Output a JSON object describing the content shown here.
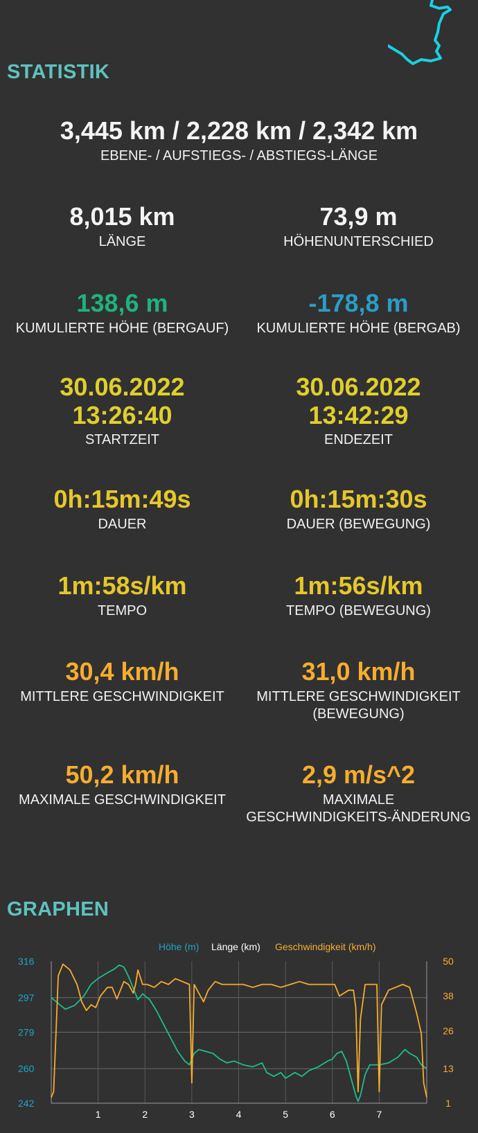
{
  "colors": {
    "background": "#313131",
    "section_title": "#5fc2bd",
    "elevation": "#1ea6c9",
    "distance": "#ffffff",
    "speed": "#f6ad2e",
    "elevation_line": "#1dbd8e"
  },
  "stats_title": "STATISTIK",
  "graphs_title": "GRAPHEN",
  "stats": {
    "segment_lengths": {
      "value": "3,445 km / 2,228 km / 2,342 km",
      "label": "EBENE- / AUFSTIEGS- / ABSTIEGS-LÄNGE"
    },
    "length": {
      "value": "8,015 km",
      "label": "LÄNGE"
    },
    "height_diff": {
      "value": "73,9 m",
      "label": "HÖHENUNTERSCHIED"
    },
    "ascent": {
      "value": "138,6 m",
      "label": "KUMULIERTE HÖHE (BERGAUF)"
    },
    "descent": {
      "value": "-178,8 m",
      "label": "KUMULIERTE HÖHE (BERGAB)"
    },
    "start": {
      "date": "30.06.2022",
      "time": "13:26:40",
      "label": "STARTZEIT"
    },
    "end": {
      "date": "30.06.2022",
      "time": "13:42:29",
      "label": "ENDEZEIT"
    },
    "duration": {
      "value": "0h:15m:49s",
      "label": "DAUER"
    },
    "duration_moving": {
      "value": "0h:15m:30s",
      "label": "DAUER (BEWEGUNG)"
    },
    "pace": {
      "value": "1m:58s/km",
      "label": "TEMPO"
    },
    "pace_moving": {
      "value": "1m:56s/km",
      "label": "TEMPO (BEWEGUNG)"
    },
    "avg_speed": {
      "value": "30,4 km/h",
      "label": "MITTLERE GESCHWINDIGKEIT"
    },
    "avg_speed_moving": {
      "value": "31,0 km/h",
      "label_line1": "MITTLERE GESCHWINDIGKEIT",
      "label_line2": "(BEWEGUNG)"
    },
    "max_speed": {
      "value": "50,2 km/h",
      "label": "MAXIMALE GESCHWINDIGKEIT"
    },
    "max_accel": {
      "value": "2,9 m/s^2",
      "label_line1": "MAXIMALE",
      "label_line2": "GESCHWINDIGKEITS-ÄNDERUNG"
    }
  },
  "chart_data": {
    "type": "line",
    "legend": [
      "Höhe (m)",
      "Länge (km)",
      "Geschwindigkeit (km/h)"
    ],
    "x_ticks": [
      1,
      2,
      3,
      4,
      5,
      6,
      7
    ],
    "xlim": [
      0,
      8.015
    ],
    "y_left_ticks": [
      242,
      260,
      279,
      297,
      316
    ],
    "y_right_ticks": [
      1,
      13,
      26,
      38,
      50
    ],
    "ylim_left": [
      242,
      316
    ],
    "ylim_right": [
      1,
      50
    ],
    "grid": true,
    "series": [
      {
        "name": "Höhe (m)",
        "axis": "left",
        "color": "#1dbd8e",
        "points": [
          [
            0,
            297
          ],
          [
            0.15,
            294
          ],
          [
            0.3,
            291
          ],
          [
            0.5,
            293
          ],
          [
            0.7,
            298
          ],
          [
            0.85,
            304
          ],
          [
            1.0,
            307
          ],
          [
            1.2,
            310
          ],
          [
            1.35,
            312
          ],
          [
            1.45,
            314
          ],
          [
            1.55,
            313
          ],
          [
            1.65,
            308
          ],
          [
            1.75,
            302
          ],
          [
            1.85,
            296
          ],
          [
            1.95,
            299
          ],
          [
            2.0,
            298
          ],
          [
            2.1,
            296
          ],
          [
            2.25,
            290
          ],
          [
            2.4,
            283
          ],
          [
            2.55,
            276
          ],
          [
            2.7,
            269
          ],
          [
            2.85,
            264
          ],
          [
            2.95,
            262
          ],
          [
            3.05,
            268
          ],
          [
            3.15,
            270
          ],
          [
            3.3,
            269
          ],
          [
            3.45,
            268
          ],
          [
            3.6,
            265
          ],
          [
            3.75,
            263
          ],
          [
            3.9,
            264
          ],
          [
            4.1,
            262
          ],
          [
            4.3,
            261
          ],
          [
            4.5,
            263
          ],
          [
            4.6,
            258
          ],
          [
            4.75,
            256
          ],
          [
            4.9,
            258
          ],
          [
            5.0,
            255
          ],
          [
            5.2,
            258
          ],
          [
            5.35,
            256
          ],
          [
            5.5,
            259
          ],
          [
            5.7,
            261
          ],
          [
            5.9,
            264
          ],
          [
            6.0,
            265
          ],
          [
            6.1,
            268
          ],
          [
            6.2,
            269
          ],
          [
            6.3,
            264
          ],
          [
            6.4,
            255
          ],
          [
            6.5,
            246
          ],
          [
            6.55,
            243
          ],
          [
            6.6,
            246
          ],
          [
            6.7,
            257
          ],
          [
            6.8,
            262
          ],
          [
            7.0,
            262
          ],
          [
            7.2,
            263
          ],
          [
            7.4,
            266
          ],
          [
            7.55,
            270
          ],
          [
            7.65,
            268
          ],
          [
            7.8,
            266
          ],
          [
            7.9,
            262
          ],
          [
            8.015,
            260
          ]
        ]
      },
      {
        "name": "Geschwindigkeit (km/h)",
        "axis": "right",
        "color": "#f6ad2e",
        "points": [
          [
            0,
            3
          ],
          [
            0.05,
            5
          ],
          [
            0.1,
            25
          ],
          [
            0.15,
            45
          ],
          [
            0.25,
            49
          ],
          [
            0.4,
            47
          ],
          [
            0.55,
            42
          ],
          [
            0.65,
            36
          ],
          [
            0.75,
            33
          ],
          [
            0.85,
            35
          ],
          [
            0.95,
            34
          ],
          [
            1.05,
            38
          ],
          [
            1.2,
            41
          ],
          [
            1.3,
            41
          ],
          [
            1.4,
            37
          ],
          [
            1.55,
            43
          ],
          [
            1.65,
            42
          ],
          [
            1.75,
            39
          ],
          [
            1.8,
            42
          ],
          [
            1.85,
            47
          ],
          [
            1.95,
            42
          ],
          [
            2.05,
            42
          ],
          [
            2.2,
            41
          ],
          [
            2.35,
            43
          ],
          [
            2.5,
            42
          ],
          [
            2.65,
            44
          ],
          [
            2.8,
            43
          ],
          [
            2.95,
            42
          ],
          [
            3.0,
            8
          ],
          [
            3.05,
            42
          ],
          [
            3.15,
            39
          ],
          [
            3.25,
            36
          ],
          [
            3.35,
            40
          ],
          [
            3.5,
            43
          ],
          [
            3.65,
            42
          ],
          [
            3.8,
            42
          ],
          [
            3.95,
            42
          ],
          [
            4.1,
            42
          ],
          [
            4.3,
            41
          ],
          [
            4.5,
            42
          ],
          [
            4.7,
            42
          ],
          [
            4.9,
            41
          ],
          [
            5.1,
            42
          ],
          [
            5.3,
            43
          ],
          [
            5.5,
            42
          ],
          [
            5.7,
            42
          ],
          [
            5.9,
            42
          ],
          [
            6.05,
            42
          ],
          [
            6.15,
            38
          ],
          [
            6.25,
            39
          ],
          [
            6.35,
            40
          ],
          [
            6.45,
            40
          ],
          [
            6.5,
            34
          ],
          [
            6.55,
            5
          ],
          [
            6.6,
            30
          ],
          [
            6.7,
            42
          ],
          [
            6.8,
            42
          ],
          [
            6.95,
            42
          ],
          [
            7.0,
            5
          ],
          [
            7.05,
            35
          ],
          [
            7.2,
            40
          ],
          [
            7.35,
            41
          ],
          [
            7.5,
            42
          ],
          [
            7.65,
            41
          ],
          [
            7.8,
            32
          ],
          [
            7.9,
            25
          ],
          [
            7.95,
            8
          ],
          [
            8.015,
            3
          ]
        ]
      }
    ]
  }
}
